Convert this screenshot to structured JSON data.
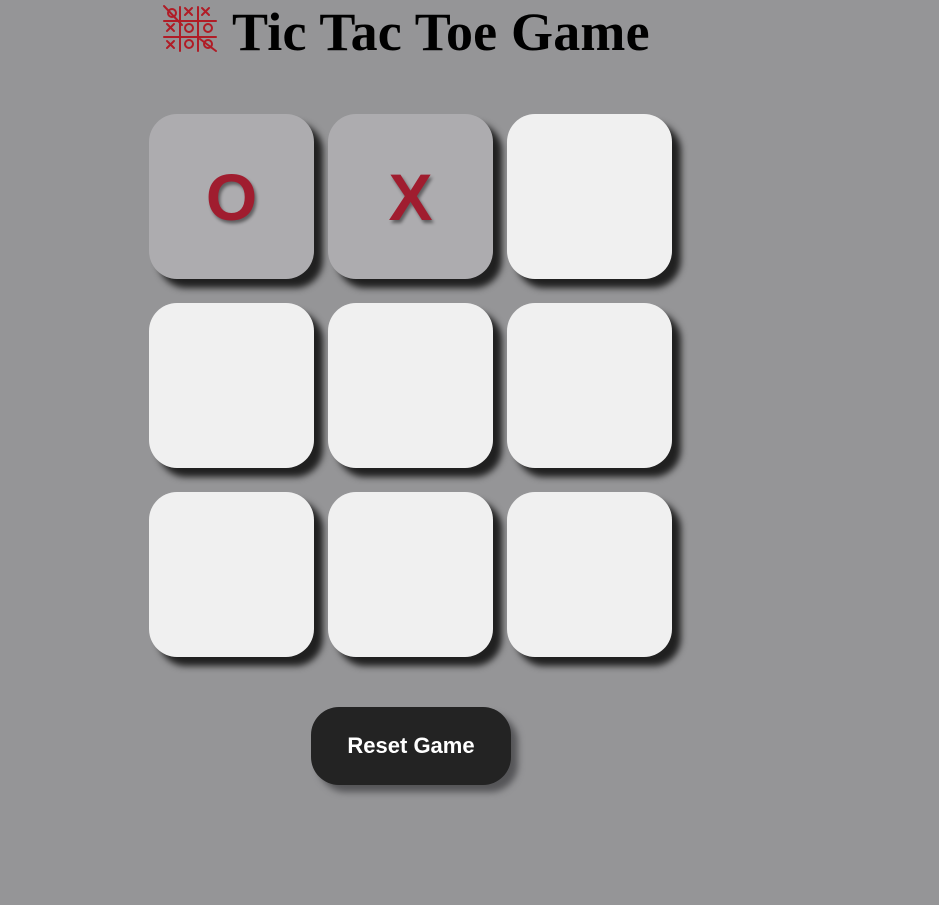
{
  "header": {
    "title": "Tic Tac Toe Game"
  },
  "board": {
    "cells": [
      {
        "mark": "O"
      },
      {
        "mark": "X"
      },
      {
        "mark": ""
      },
      {
        "mark": ""
      },
      {
        "mark": ""
      },
      {
        "mark": ""
      },
      {
        "mark": ""
      },
      {
        "mark": ""
      },
      {
        "mark": ""
      }
    ]
  },
  "controls": {
    "reset_label": "Reset Game"
  },
  "colors": {
    "background": "#959597",
    "empty_cell": "#f0f0f0",
    "filled_cell": "#adacaf",
    "mark": "#a01d2f",
    "button": "#232323"
  },
  "icons": {
    "logo": "tic-tac-toe-icon"
  }
}
